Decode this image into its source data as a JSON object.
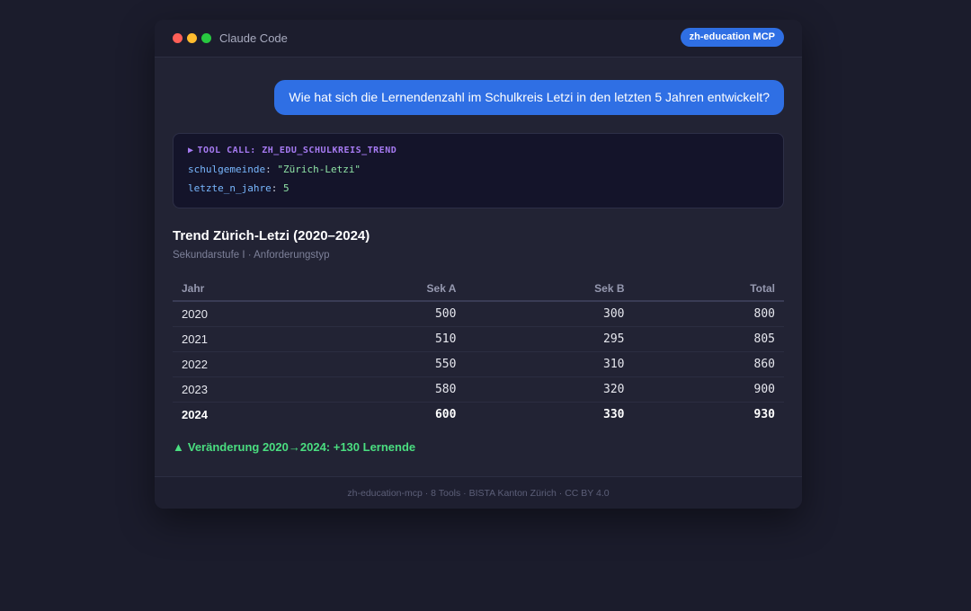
{
  "window": {
    "title": "Claude Code",
    "badge": "zh-education MCP"
  },
  "user_message": "Wie hat sich die Lernendenzahl im Schulkreis Letzi in den letzten 5 Jahren entwickelt?",
  "tool_call": {
    "header": "TOOL CALL: ZH_EDU_SCHULKREIS_TREND",
    "params": [
      {
        "key": "schulgemeinde",
        "value": "\"Zürich-Letzi\""
      },
      {
        "key": "letzte_n_jahre",
        "value": "5"
      }
    ]
  },
  "result": {
    "title": "Trend Zürich-Letzi (2020–2024)",
    "subtitle": "Sekundarstufe I · Anforderungstyp",
    "columns": [
      "Jahr",
      "Sek A",
      "Sek B",
      "Total"
    ],
    "rows": [
      [
        "2020",
        "500",
        "300",
        "800"
      ],
      [
        "2021",
        "510",
        "295",
        "805"
      ],
      [
        "2022",
        "550",
        "310",
        "860"
      ],
      [
        "2023",
        "580",
        "320",
        "900"
      ],
      [
        "2024",
        "600",
        "330",
        "930"
      ]
    ],
    "change_icon": "triangle-up-icon",
    "change": "Veränderung 2020→2024: +130 Lernende"
  },
  "footer": "zh-education-mcp · 8 Tools · BISTA Kanton Zürich · CC BY 4.0",
  "colors": {
    "accent": "#2f6fe4",
    "tool_header": "#a77bf3",
    "positive": "#4ade80",
    "background": "#1b1c2c"
  }
}
